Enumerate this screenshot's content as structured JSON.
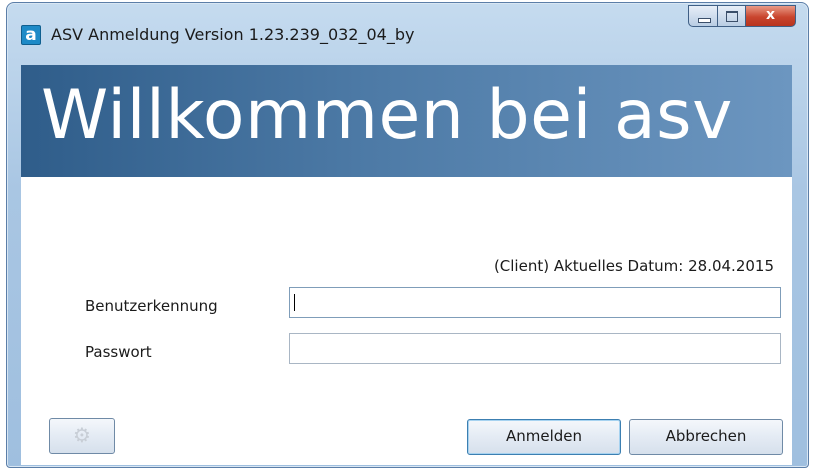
{
  "window": {
    "app_icon_letter": "a",
    "title": "ASV Anmeldung Version 1.23.239_032_04_by",
    "controls": {
      "minimize_icon": "minimize-icon",
      "maximize_icon": "maximize-icon",
      "close_icon": "close-icon",
      "close_glyph": "x"
    }
  },
  "banner": {
    "title": "Willkommen bei asv"
  },
  "form": {
    "date_text": "(Client) Aktuelles Datum: 28.04.2015",
    "user_label": "Benutzerkennung",
    "user_value": "",
    "password_label": "Passwort",
    "password_value": ""
  },
  "buttons": {
    "settings_icon": "gear-icon",
    "settings_glyph": "⚙",
    "login_label": "Anmelden",
    "cancel_label": "Abbrechen"
  },
  "colors": {
    "banner_dark": "#2f5d8a",
    "banner_light": "#6c96c0",
    "close_button": "#c9452e",
    "window_frame": "#a9c6e3"
  }
}
